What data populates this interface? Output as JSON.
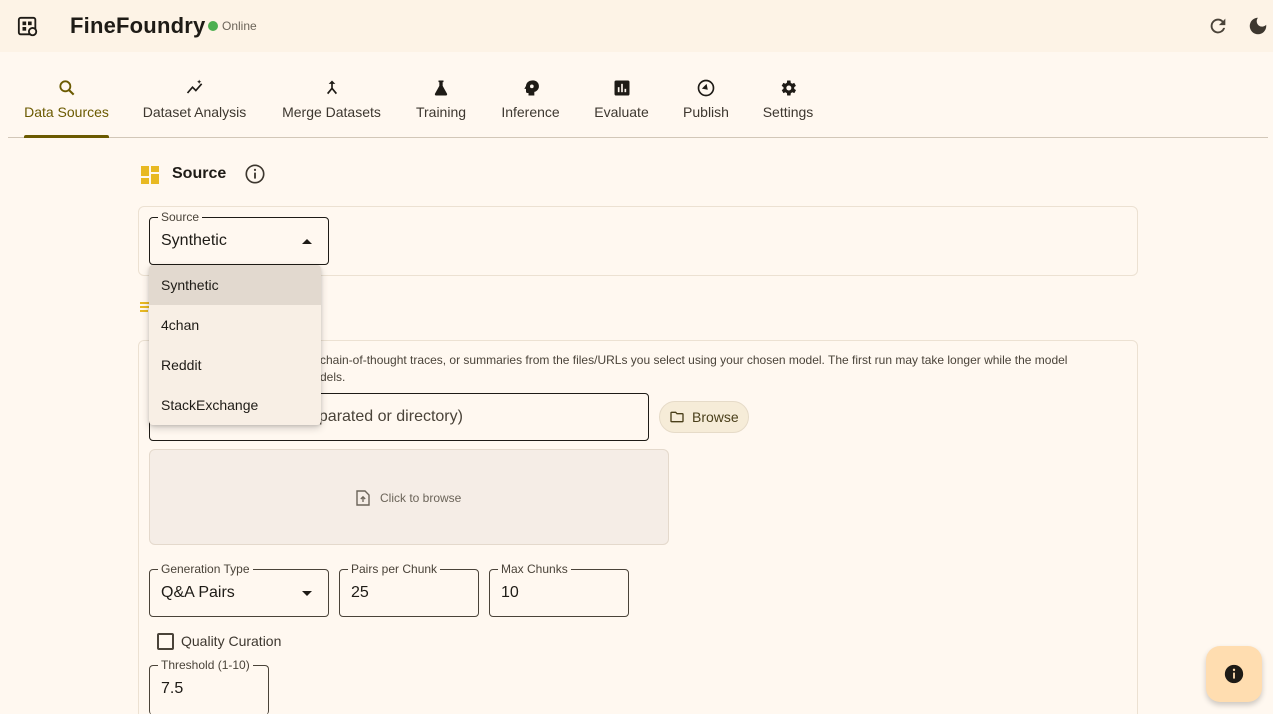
{
  "app": {
    "title": "FineFoundry",
    "status": "Online",
    "status_color": "#4caf50",
    "accent": "#6b5a00"
  },
  "tabs": [
    {
      "label": "Data Sources",
      "icon": "search-icon",
      "active": true
    },
    {
      "label": "Dataset Analysis",
      "icon": "insights-icon",
      "active": false
    },
    {
      "label": "Merge Datasets",
      "icon": "merge-icon",
      "active": false
    },
    {
      "label": "Training",
      "icon": "flask-icon",
      "active": false
    },
    {
      "label": "Inference",
      "icon": "psychology-icon",
      "active": false
    },
    {
      "label": "Evaluate",
      "icon": "bar-chart-icon",
      "active": false
    },
    {
      "label": "Publish",
      "icon": "publish-icon",
      "active": false
    },
    {
      "label": "Settings",
      "icon": "gear-icon",
      "active": false
    }
  ],
  "source_section": {
    "title": "Source",
    "field_label": "Source",
    "selected": "Synthetic",
    "options": [
      "Synthetic",
      "4chan",
      "Reddit",
      "StackExchange"
    ]
  },
  "main": {
    "description_visible": "chain-of-thought traces, or summaries from the files/URLs you select using your chosen model. The first run may take longer while the model",
    "description_line2": "dels.",
    "paths_placeholder_visible": "eparated or directory)",
    "browse_label": "Browse",
    "drop_text": "Click to browse",
    "generation_type_label": "Generation Type",
    "generation_type_value": "Q&A Pairs",
    "pairs_per_chunk_label": "Pairs per Chunk",
    "pairs_per_chunk_value": "25",
    "max_chunks_label": "Max Chunks",
    "max_chunks_value": "10",
    "quality_curation_label": "Quality Curation",
    "quality_curation_checked": false,
    "threshold_label": "Threshold (1-10)",
    "threshold_value": "7.5"
  }
}
